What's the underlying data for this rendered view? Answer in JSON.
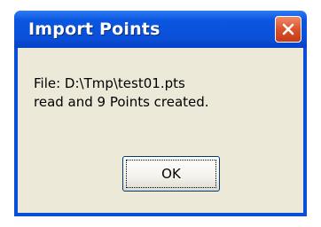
{
  "dialog": {
    "title": "Import Points",
    "message_line1": "File: D:\\Tmp\\test01.pts",
    "message_line2": "read and 9 Points created.",
    "ok_label": "OK"
  },
  "icons": {
    "close": "close-icon"
  },
  "colors": {
    "titlebar": "#0a4fd8",
    "close_button": "#d9532c",
    "content_bg": "#ece9d8"
  }
}
